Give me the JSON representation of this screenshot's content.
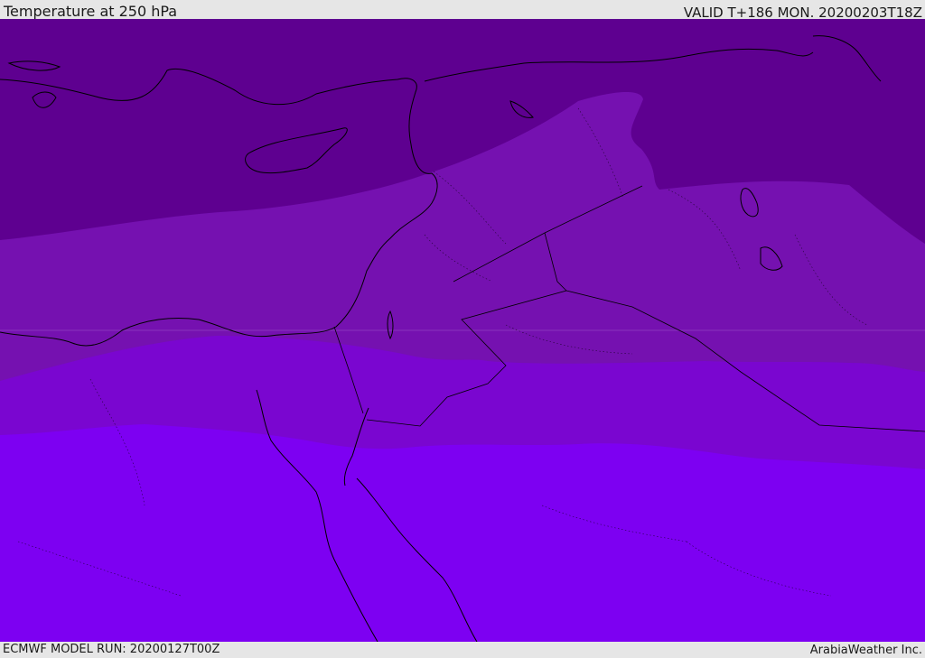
{
  "header": {
    "title": "Temperature at 250 hPa",
    "valid": "VALID T+186 MON. 20200203T18Z"
  },
  "footer": {
    "model_run": "ECMWF MODEL RUN: 20200127T00Z",
    "credit": "ArabiaWeather Inc."
  },
  "map": {
    "band_colors": [
      "#5e0090",
      "#7511b0",
      "#7a06d0",
      "#7d00f2"
    ]
  }
}
